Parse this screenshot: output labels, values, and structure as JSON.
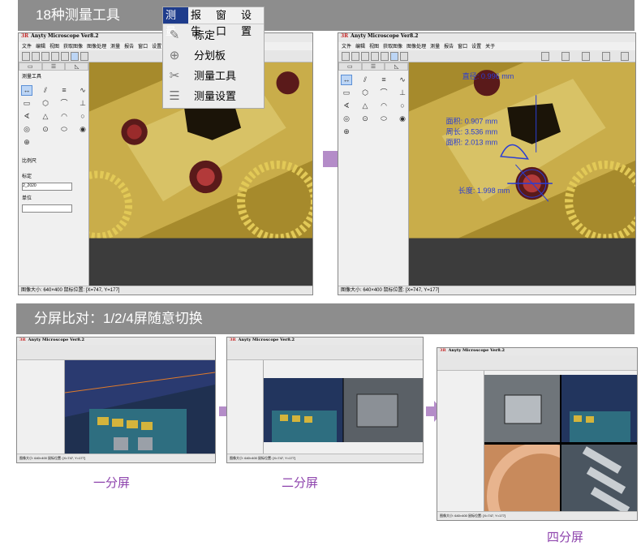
{
  "banner_top": "18种测量工具",
  "banner_mid": "分屏比对：1/2/4屏随意切换",
  "menu": {
    "bar": [
      "测量",
      "报告",
      "窗口",
      "设置"
    ],
    "active": "测量",
    "items": [
      "标定",
      "分划板",
      "测量工具",
      "测量设置"
    ]
  },
  "app": {
    "title": "Anyty Microscope Ver8.2",
    "menubar": [
      "文件",
      "编辑",
      "视图",
      "获取图像",
      "图像处理",
      "测量",
      "报告",
      "窗口",
      "设置",
      "关于"
    ],
    "tabs": [
      "▭",
      "☰",
      "◺"
    ],
    "tools_label": "测量工具",
    "scale_label": "比例尺",
    "calib_label": "标定",
    "calib_value": "2_2020",
    "unit_label": "单位",
    "status": "图像大小: 640×400  鼠标位置: [X=747, Y=177]",
    "status_short": "图像大小: 640×400  鼠标位置: [X=747, Y=177]"
  },
  "annotations": {
    "l1": "直径: 0.996 mm",
    "l2": "面积: 0.907 mm",
    "l3": "周长: 3.536 mm",
    "l4": "面积: 2.013 mm",
    "l5": "长度: 1.998 mm"
  },
  "captions": {
    "one": "一分屏",
    "two": "二分屏",
    "four": "四分屏"
  },
  "colors": {
    "banner": "#8d8d8d",
    "arrow": "#b48cc8",
    "caption": "#8e44ad",
    "menu_active": "#1e3c8c"
  }
}
